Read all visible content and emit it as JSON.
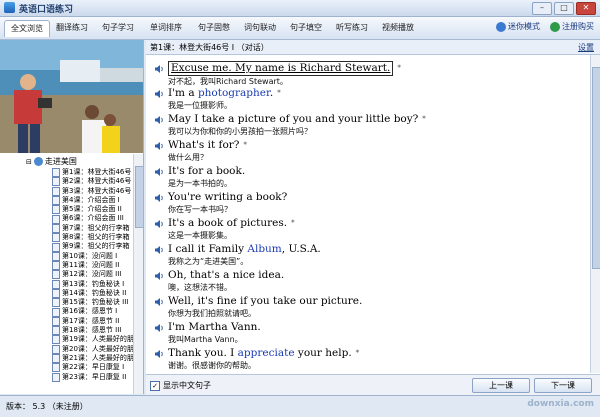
{
  "app": {
    "title": "英语口语练习"
  },
  "tabs": [
    "全文浏览",
    "翻译练习",
    "句子学习",
    "单词排序",
    "句子固憋",
    "词句联动",
    "句子填空",
    "听写练习",
    "视频播放"
  ],
  "toolbar_right": [
    {
      "label": "迷你模式"
    },
    {
      "label": "注册购买"
    }
  ],
  "lesson": {
    "title": "第1课：林登大街46号 I （对话）",
    "settings_label": "设置"
  },
  "sentences": [
    {
      "en": "Excuse me. My name is Richard Stewart.",
      "mark": "*",
      "zh": "对不起，我叫Richard Stewart。"
    },
    {
      "en_pre": "I'm a ",
      "en_hl": "photographer",
      "en_post": ".",
      "mark": "*",
      "zh": "我是一位摄影师。"
    },
    {
      "en": "May I take a picture of you and your little boy?",
      "mark": "*",
      "zh": "我可以为你和你的小男孩拍一张照片吗？"
    },
    {
      "en": "What's it for?",
      "mark": "*",
      "zh": "做什么用？"
    },
    {
      "en": "It's for a book.",
      "mark": "",
      "zh": "是为一本书拍的。"
    },
    {
      "en": "You're writing a book?",
      "mark": "",
      "zh": "你在写一本书吗？"
    },
    {
      "en": "It's a book of pictures.",
      "mark": "*",
      "zh": "这是一本摄影集。"
    },
    {
      "en_pre": "I call it Family ",
      "en_hl": "Album",
      "en_post": ", U.S.A.",
      "mark": "",
      "zh": "我称之为“走进美国”。"
    },
    {
      "en": "Oh, that's a nice idea.",
      "mark": "",
      "zh": "噢，这想法不错。"
    },
    {
      "en": "Well, it's fine if you take our picture.",
      "mark": "",
      "zh": "你想为我们拍照就请吧。"
    },
    {
      "en": "I'm Martha Vann.",
      "mark": "",
      "zh": "我叫Martha Vann。"
    },
    {
      "en_pre": "Thank you. I ",
      "en_hl": "appreciate",
      "en_post": " your help.",
      "mark": "*",
      "zh": "谢谢。很感谢你的帮助。"
    }
  ],
  "tree": {
    "root": "走进美国",
    "items": [
      "第1课：林登大街46号",
      "第2课：林登大街46号",
      "第3课：林登大街46号",
      "第4课：介绍会面 I",
      "第5课：介绍会面 II",
      "第6课：介绍会面 III",
      "第7课：祖父的行李箱",
      "第8课：祖父的行李箱",
      "第9课：祖父的行李箱",
      "第10课：没问题 I",
      "第11课：没问题 II",
      "第12课：没问题 III",
      "第13课：钓鱼秘诀 I",
      "第14课：钓鱼秘诀 II",
      "第15课：钓鱼秘诀 III",
      "第16课：感恩节 I",
      "第17课：感恩节 II",
      "第18课：感恩节 III",
      "第19课：人类最好的朋友",
      "第20课：人类最好的朋友",
      "第21课：人类最好的朋友",
      "第22课：早日康复 I",
      "第23课：早日康复 II"
    ]
  },
  "bottom": {
    "show_chinese": "显示中文句子",
    "prev": "上一课",
    "next": "下一课"
  },
  "status": {
    "text": "版本： 5.3  （未注册）",
    "watermark": "downxia.com"
  },
  "colors": {
    "highlight": "#1a3bb0",
    "frame": "#dfe8f3"
  }
}
